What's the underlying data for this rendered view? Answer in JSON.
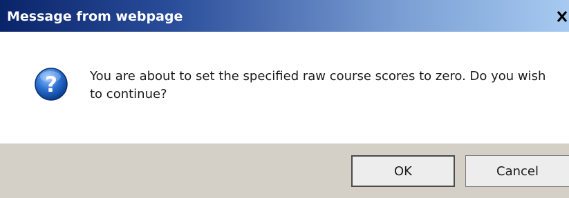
{
  "window": {
    "title": "Message from webpage",
    "close_icon": "close-x-icon"
  },
  "message": {
    "icon": "question-icon",
    "text": "You are about to set the specified raw course scores to zero. Do you wish to continue?"
  },
  "buttons": {
    "ok_label": "OK",
    "cancel_label": "Cancel"
  },
  "colors": {
    "titlebar_start": "#0a246a",
    "titlebar_end": "#a6caf0",
    "button_bar": "#d4d0c8",
    "icon_blue": "#1f5fbf"
  }
}
